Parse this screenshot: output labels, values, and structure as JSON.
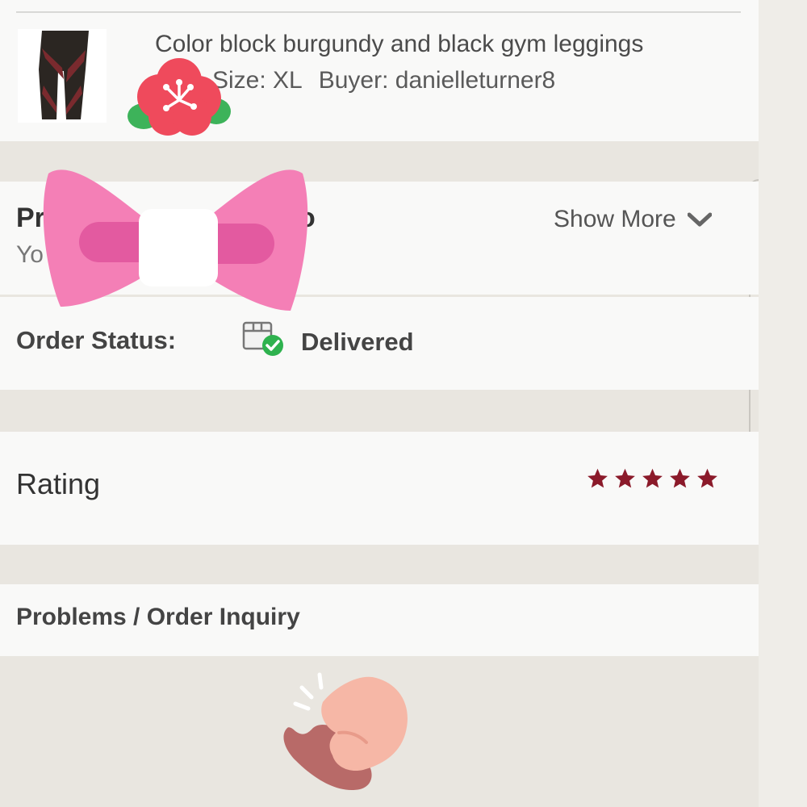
{
  "product": {
    "title": "Color block burgundy and black gym leggings",
    "size": "Size: XL",
    "buyer": "Buyer: danielleturner8"
  },
  "info_section": {
    "title_visible": "Pr",
    "title_visible_end": "o",
    "sub_visible": "Yo",
    "show_more": "Show More"
  },
  "order_status": {
    "label": "Order Status:",
    "value": "Delivered"
  },
  "rating": {
    "label": "Rating",
    "stars": 5,
    "max_stars": 5
  },
  "problems": {
    "label": "Problems / Order Inquiry"
  },
  "icons": {
    "delivered": "package-check-icon",
    "chevron": "chevron-down-icon",
    "star": "star-icon"
  },
  "colors": {
    "star": "#8b1a2a",
    "check": "#2eb24e",
    "bow": "#f47fb6",
    "flower": "#ef4a5c"
  }
}
